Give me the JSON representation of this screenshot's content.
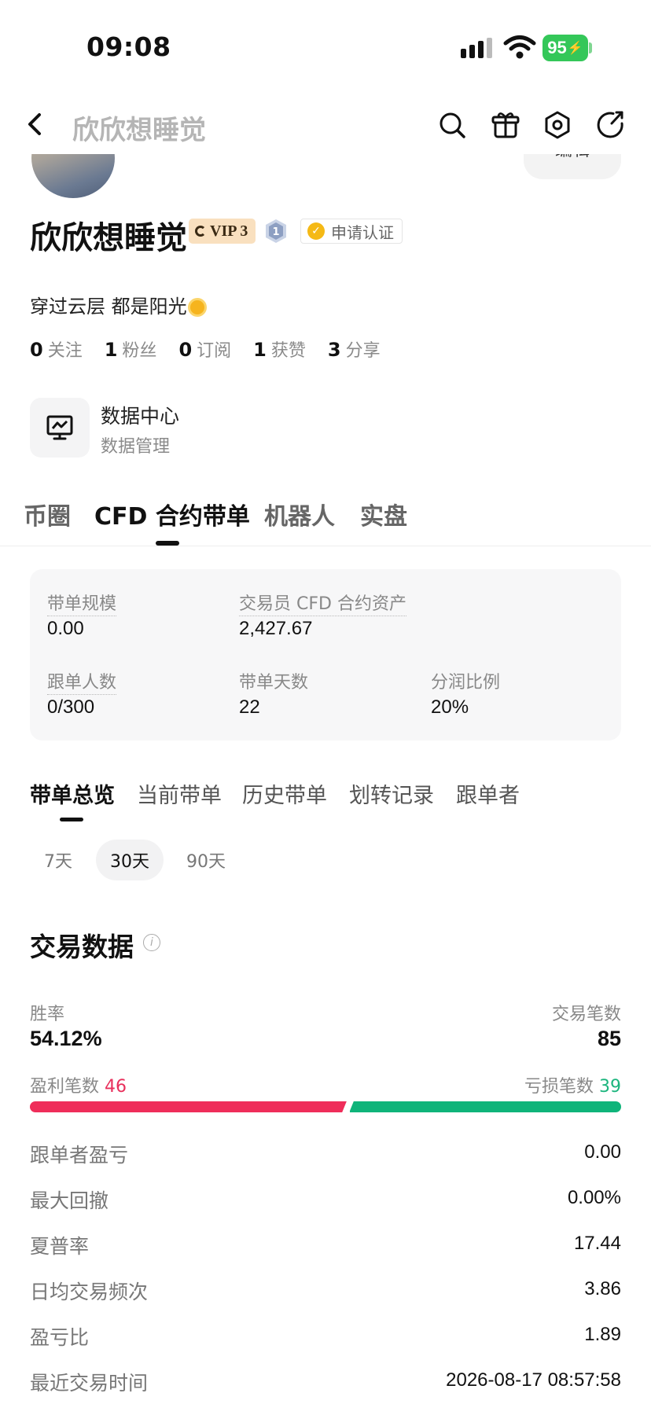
{
  "status_bar": {
    "time": "09:08",
    "battery": "95"
  },
  "nav": {
    "title": "欣欣想睡觉"
  },
  "profile": {
    "edit_label": "编辑",
    "nickname": "欣欣想睡觉",
    "vip": "VIP 3",
    "level": "1",
    "verify_label": "申请认证",
    "bio": "穿过云层  都是阳光",
    "stats": [
      {
        "value": "0",
        "label": "关注"
      },
      {
        "value": "1",
        "label": "粉丝"
      },
      {
        "value": "0",
        "label": "订阅"
      },
      {
        "value": "1",
        "label": "获赞"
      },
      {
        "value": "3",
        "label": "分享"
      }
    ]
  },
  "data_center": {
    "title": "数据中心",
    "subtitle": "数据管理"
  },
  "main_tabs": [
    "币圈",
    "CFD 合约带单",
    "机器人",
    "实盘"
  ],
  "summary": {
    "scale_label": "带单规模",
    "scale_value": "0.00",
    "assets_label": "交易员 CFD 合约资产",
    "assets_value": "2,427.67",
    "followers_label": "跟单人数",
    "followers_value": "0/300",
    "days_label": "带单天数",
    "days_value": "22",
    "share_label": "分润比例",
    "share_value": "20%"
  },
  "sub_tabs": [
    "带单总览",
    "当前带单",
    "历史带单",
    "划转记录",
    "跟单者"
  ],
  "periods": [
    "7天",
    "30天",
    "90天"
  ],
  "trading": {
    "title": "交易数据",
    "win_rate_label": "胜率",
    "win_rate": "54.12%",
    "trades_label": "交易笔数",
    "trades": "85",
    "profit_label": "盈利笔数",
    "profit_count": "46",
    "loss_label": "亏损笔数",
    "loss_count": "39",
    "profit_fraction": 0.5412,
    "colors": {
      "profit": "#ef2d5a",
      "loss": "#0fb47a"
    },
    "rows": [
      {
        "label": "跟单者盈亏",
        "value": "0.00"
      },
      {
        "label": "最大回撤",
        "value": "0.00%"
      },
      {
        "label": "夏普率",
        "value": "17.44"
      },
      {
        "label": "日均交易频次",
        "value": "3.86"
      },
      {
        "label": "盈亏比",
        "value": "1.89"
      },
      {
        "label": "最近交易时间",
        "value": "2026-08-17 08:57:58"
      }
    ]
  }
}
